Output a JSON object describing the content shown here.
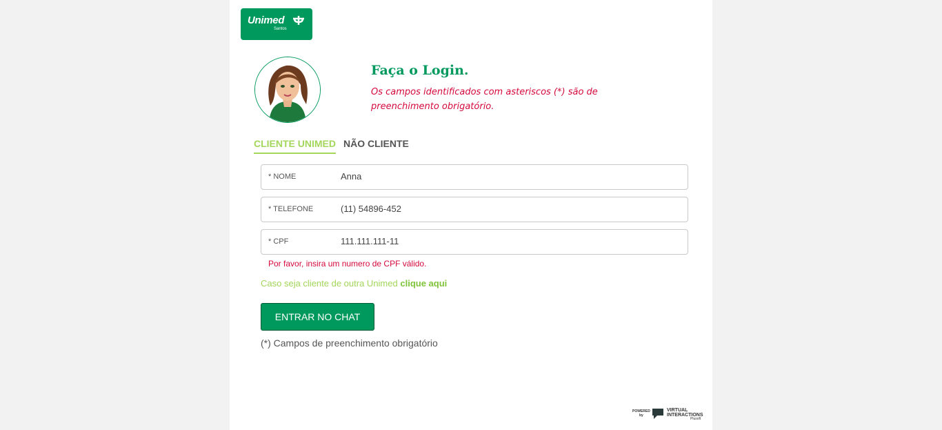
{
  "logo": {
    "brand": "Unimed",
    "sub": "Santos"
  },
  "header": {
    "title": "Faça o Login.",
    "subtitle": "Os campos identificados com asteriscos (*) são de preenchimento obrigatório."
  },
  "tabs": [
    {
      "label": "CLIENTE UNIMED",
      "active": true
    },
    {
      "label": "NÃO CLIENTE",
      "active": false
    }
  ],
  "form": {
    "fields": [
      {
        "label": "* NOME",
        "value": "Anna"
      },
      {
        "label": "* TELEFONE",
        "value": "(11) 54896-452"
      },
      {
        "label": "* CPF",
        "value": "111.111.111-11"
      }
    ],
    "cpf_error": "Por favor, insira um numero de CPF válido.",
    "other_unimed_text": "Caso seja cliente de outra Unimed",
    "other_unimed_link": "clique aqui",
    "submit_label": "ENTRAR NO CHAT",
    "required_note": "(*) Campos de preenchimento obrigatório"
  },
  "footer": {
    "powered_line1": "POWERED",
    "powered_line2": "by",
    "brand_line1": "VIRTUAL",
    "brand_line2": "INTERACTIONS",
    "brand_line3": "Plusoft"
  },
  "colors": {
    "brand_green": "#00995d",
    "light_green": "#a3d65b",
    "error_red": "#d5083c"
  },
  "icons": [
    "unimed-logo-icon",
    "avatar-image",
    "virtual-interactions-logo-icon"
  ]
}
